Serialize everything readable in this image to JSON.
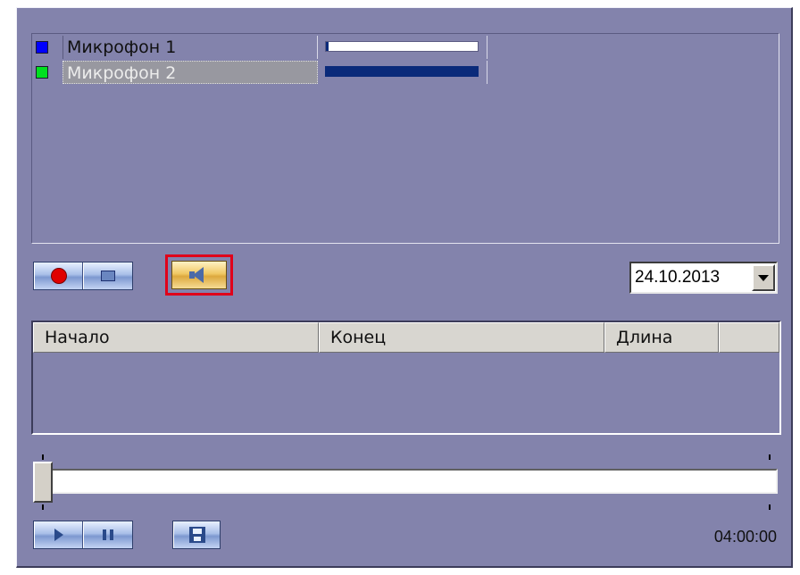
{
  "microphones": [
    {
      "name": "Микрофон 1",
      "color": "#0000ff",
      "level": 0.02,
      "selected": false
    },
    {
      "name": "Микрофон 2",
      "color": "#00e020",
      "level": 1.0,
      "selected": true
    }
  ],
  "controls": {
    "record_icon": "record-icon",
    "stop_icon": "stop-icon",
    "sound_icon": "speaker-icon"
  },
  "date": {
    "value": "24.10.2013"
  },
  "table": {
    "columns": [
      "Начало",
      "Конец",
      "Длина",
      ""
    ],
    "rows": []
  },
  "timeline": {
    "position": 0.0
  },
  "playback": {
    "play_icon": "play-icon",
    "pause_icon": "pause-icon",
    "save_icon": "save-icon",
    "time": "04:00:00"
  },
  "colors": {
    "panel": "#8383ac",
    "highlight": "#e0001a"
  }
}
